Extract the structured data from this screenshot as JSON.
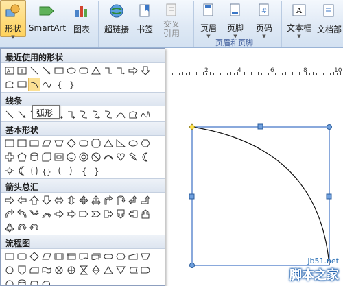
{
  "ribbon": {
    "shapes_label": "形状",
    "smartart_label": "SmartArt",
    "chart_label": "图表",
    "hyperlink_label": "超链接",
    "bookmark_label": "书签",
    "crossref_label": "交叉\n引用",
    "header_label": "页眉",
    "footer_label": "页脚",
    "pagenum_label": "页码",
    "textbox_label": "文本框",
    "docparts_label": "文档部",
    "group_header_footer": "页眉和页脚"
  },
  "dropdown": {
    "recent_title": "最近使用的形状",
    "lines_title": "线条",
    "basic_title": "基本形状",
    "arrows_title": "箭头总汇",
    "flowchart_title": "流程图",
    "tooltip": "弧形"
  },
  "ruler": {
    "numbers": [
      "2",
      "4",
      "6",
      "8",
      "10"
    ]
  },
  "watermark": {
    "site": "jb51.net",
    "brand": "脚本之家"
  },
  "colors": {
    "accent": "#ffd25c",
    "handle": "#5b8fd0",
    "selection": "#3c70c4",
    "watermark": "#1d5fae"
  }
}
